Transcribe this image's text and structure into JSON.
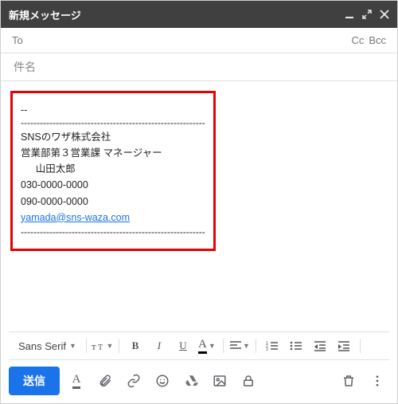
{
  "window": {
    "title": "新規メッセージ"
  },
  "fields": {
    "to_label": "To",
    "cc_label": "Cc",
    "bcc_label": "Bcc",
    "subject_placeholder": "件名"
  },
  "body": {
    "dash": "--"
  },
  "signature": {
    "company": "SNSのワザ株式会社",
    "dept": "営業部第３営業課 マネージャー",
    "name": "山田太郎",
    "phone1": "030-0000-0000",
    "phone2": "090-0000-0000",
    "email": "yamada@sns-waza.com"
  },
  "format": {
    "font_name": "Sans Serif",
    "bold": "B",
    "italic": "I",
    "underline": "U",
    "textcolor": "A"
  },
  "actions": {
    "send": "送信"
  }
}
